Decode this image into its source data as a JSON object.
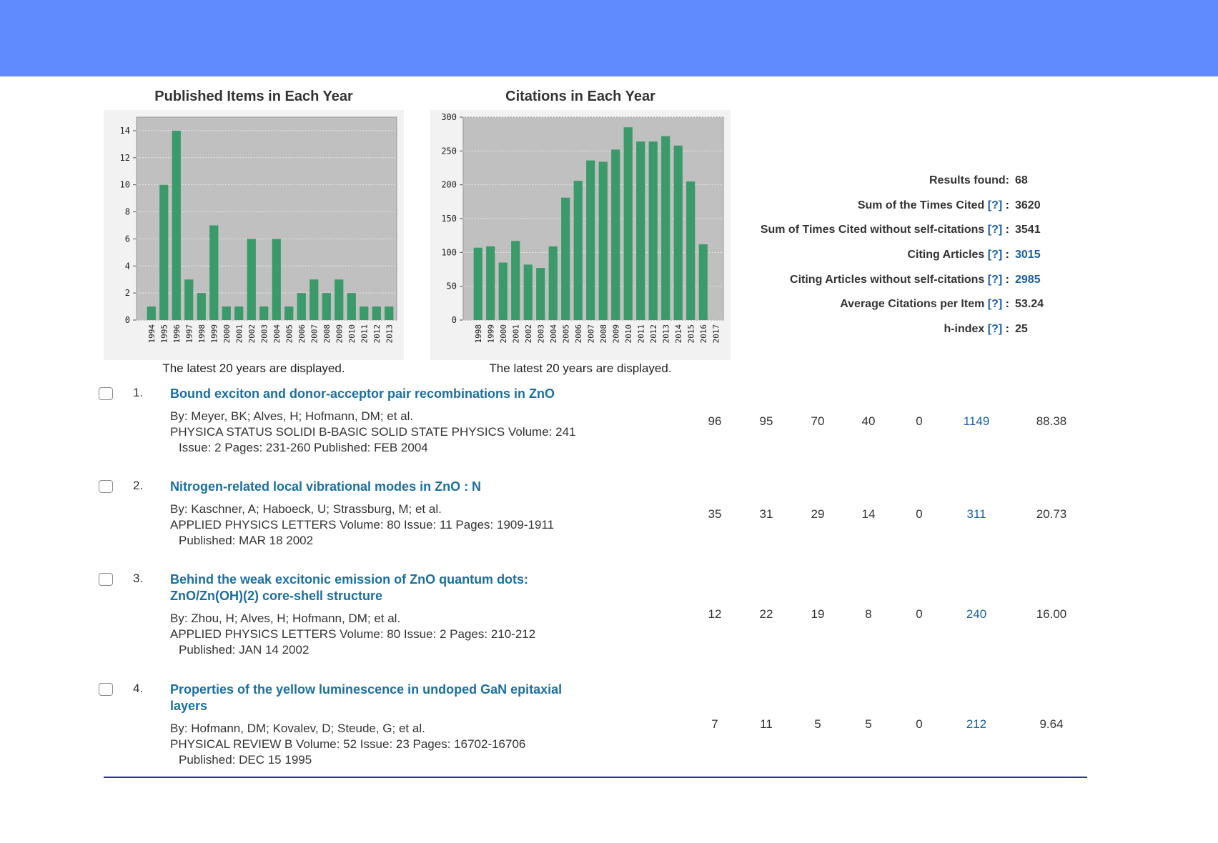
{
  "charts": {
    "published": {
      "title": "Published Items in Each Year",
      "note": "The latest 20 years are displayed.",
      "years": [
        "1994",
        "1995",
        "1996",
        "1997",
        "1998",
        "1999",
        "2000",
        "2001",
        "2002",
        "2003",
        "2004",
        "2005",
        "2006",
        "2007",
        "2008",
        "2009",
        "2010",
        "2011",
        "2012",
        "2013"
      ],
      "values": [
        1,
        10,
        14,
        3,
        2,
        7,
        1,
        1,
        6,
        1,
        6,
        1,
        2,
        3,
        2,
        3,
        2,
        1,
        1,
        1
      ],
      "yticks": [
        0,
        2,
        4,
        6,
        8,
        10,
        12,
        14
      ],
      "ymax": 15
    },
    "citations": {
      "title": "Citations in Each Year",
      "note": "The latest 20 years are displayed.",
      "years": [
        "1998",
        "1999",
        "2000",
        "2001",
        "2002",
        "2003",
        "2004",
        "2005",
        "2006",
        "2007",
        "2008",
        "2009",
        "2010",
        "2011",
        "2012",
        "2013",
        "2014",
        "2015",
        "2016",
        "2017"
      ],
      "values": [
        107,
        109,
        85,
        117,
        82,
        77,
        109,
        181,
        206,
        236,
        234,
        252,
        285,
        264,
        264,
        272,
        258,
        205,
        112
      ],
      "yticks": [
        0,
        50,
        100,
        150,
        200,
        250,
        300
      ],
      "ymax": 300
    }
  },
  "chart_data": [
    {
      "type": "bar",
      "title": "Published Items in Each Year",
      "categories": [
        "1994",
        "1995",
        "1996",
        "1997",
        "1998",
        "1999",
        "2000",
        "2001",
        "2002",
        "2003",
        "2004",
        "2005",
        "2006",
        "2007",
        "2008",
        "2009",
        "2010",
        "2011",
        "2012",
        "2013"
      ],
      "values": [
        1,
        10,
        14,
        3,
        2,
        7,
        1,
        1,
        6,
        1,
        6,
        1,
        2,
        3,
        2,
        3,
        2,
        1,
        1,
        1
      ],
      "ylim": [
        0,
        15
      ],
      "grid": true
    },
    {
      "type": "bar",
      "title": "Citations in Each Year",
      "categories": [
        "1998",
        "1999",
        "2000",
        "2001",
        "2002",
        "2003",
        "2004",
        "2005",
        "2006",
        "2007",
        "2008",
        "2009",
        "2010",
        "2011",
        "2012",
        "2013",
        "2014",
        "2015",
        "2016",
        "2017"
      ],
      "values": [
        107,
        109,
        85,
        117,
        82,
        77,
        109,
        181,
        206,
        236,
        234,
        252,
        285,
        264,
        264,
        272,
        258,
        205,
        112
      ],
      "ylim": [
        0,
        300
      ],
      "grid": true
    }
  ],
  "stats": {
    "results_found": {
      "label": "Results found:",
      "value": "68"
    },
    "sum_times_cited": {
      "label": "Sum of the Times Cited",
      "help": "[?]",
      "colon": ":",
      "value": "3620"
    },
    "sum_without_self": {
      "label": "Sum of Times Cited without self-citations",
      "help": "[?]",
      "colon": ":",
      "value": "3541"
    },
    "citing_articles": {
      "label": "Citing Articles",
      "help": "[?]",
      "colon": ":",
      "value": "3015"
    },
    "citing_without_self": {
      "label": "Citing Articles without self-citations",
      "help": "[?]",
      "colon": ":",
      "value": "2985"
    },
    "avg_citations": {
      "label": "Average Citations per Item",
      "help": "[?]",
      "colon": ":",
      "value": "53.24"
    },
    "h_index": {
      "label": "h-index",
      "help": "[?]",
      "colon": ":",
      "value": "25"
    }
  },
  "records": [
    {
      "num": "1.",
      "title1": "Bound exciton and donor-acceptor pair recombinations in ZnO",
      "title2": "",
      "authors": "By: Meyer, BK; Alves, H; Hofmann, DM; et al.",
      "line2": "PHYSICA STATUS SOLIDI B-BASIC SOLID STATE PHYSICS  Volume: 241",
      "line3": "Issue: 2   Pages: 231-260   Published: FEB 2004",
      "c1": "96",
      "c2": "95",
      "c3": "70",
      "c4": "40",
      "c5": "0",
      "total": "1149",
      "avg": "88.38"
    },
    {
      "num": "2.",
      "title1": "Nitrogen-related local vibrational modes in ZnO : N",
      "title2": "",
      "authors": "By: Kaschner, A; Haboeck, U; Strassburg, M; et al.",
      "line2": "APPLIED PHYSICS LETTERS  Volume: 80   Issue: 11   Pages: 1909-1911",
      "line3": "Published: MAR 18 2002",
      "c1": "35",
      "c2": "31",
      "c3": "29",
      "c4": "14",
      "c5": "0",
      "total": "311",
      "avg": "20.73"
    },
    {
      "num": "3.",
      "title1": "Behind the weak excitonic emission of ZnO quantum dots:",
      "title2": "ZnO/Zn(OH)(2) core-shell structure",
      "authors": "By: Zhou, H; Alves, H; Hofmann, DM; et al.",
      "line2": "APPLIED PHYSICS LETTERS  Volume: 80   Issue: 2   Pages: 210-212",
      "line3": "Published: JAN 14 2002",
      "c1": "12",
      "c2": "22",
      "c3": "19",
      "c4": "8",
      "c5": "0",
      "total": "240",
      "avg": "16.00"
    },
    {
      "num": "4.",
      "title1": "Properties of the yellow luminescence in undoped GaN epitaxial",
      "title2": "layers",
      "authors": "By: Hofmann, DM; Kovalev, D; Steude, G; et al.",
      "line2": "PHYSICAL REVIEW B  Volume: 52   Issue: 23   Pages: 16702-16706",
      "line3": "Published: DEC 15 1995",
      "c1": "7",
      "c2": "11",
      "c3": "5",
      "c4": "5",
      "c5": "0",
      "total": "212",
      "avg": "9.64"
    }
  ]
}
